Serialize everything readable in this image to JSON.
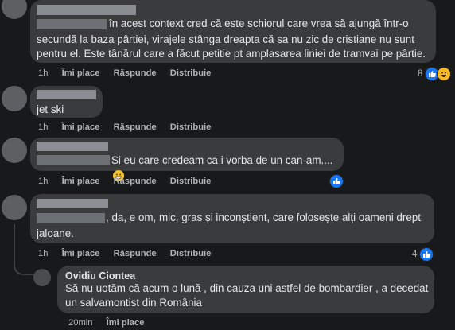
{
  "comments": [
    {
      "text_line1": "în acest context cred că este schiorul care vrea să ajungă într-o",
      "text_line2": "secundă la baza pârtiei, virajele stânga dreapta că sa nu zic de cristiane nu sunt",
      "text_line3": "pentru el. Este tânărul care a făcut petitie pt amplasarea liniei de tramvai pe pârtie.",
      "time": "1h",
      "like": "Îmi place",
      "reply": "Răspunde",
      "share": "Distribuie",
      "reaction_count": "8"
    },
    {
      "text_line1": "jet ski",
      "time": "1h",
      "like": "Îmi place",
      "reply": "Răspunde",
      "share": "Distribuie"
    },
    {
      "text_line1": "Si eu care credeam ca i vorba de un can-am....",
      "time": "1h",
      "like": "Îmi place",
      "reply": "Răspunde",
      "share": "Distribuie"
    },
    {
      "text_line1": ", da, e om, mic, gras și inconștient, care folosește alți oameni drept",
      "text_line2": "jaloane.",
      "time": "1h",
      "like": "Îmi place",
      "reply": "Răspunde",
      "share": "Distribuie",
      "reaction_count": "4"
    }
  ],
  "reply": {
    "author": "Ovidiu Ciontea",
    "text_line1": "Să nu uotăm că acum o lună , din cauza uni astfel de bombardier , a decedat",
    "text_line2": "un salvamontist din România",
    "time": "20min",
    "like": "Îmi place"
  },
  "colors": {
    "background": "#18191a",
    "bubble": "#3a3b3c",
    "like_blue": "#1877f2"
  },
  "icons": [
    "like-icon",
    "haha-icon",
    "grin-emoji-icon"
  ]
}
